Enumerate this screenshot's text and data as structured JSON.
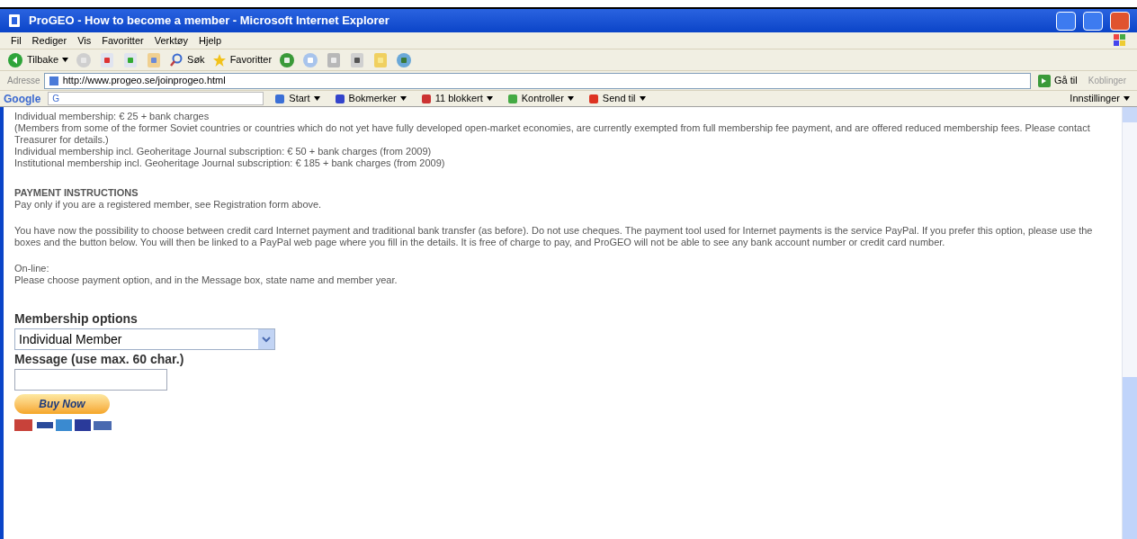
{
  "window": {
    "title": "ProGEO - How to become a member - Microsoft Internet Explorer"
  },
  "menu": [
    "Fil",
    "Rediger",
    "Vis",
    "Favoritter",
    "Verktøy",
    "Hjelp"
  ],
  "toolbar": {
    "back": "Tilbake",
    "search": "Søk",
    "favorites": "Favoritter"
  },
  "address": {
    "label": "Adresse",
    "url": "http://www.progeo.se/joinprogeo.html",
    "go": "Gå til",
    "links": "Koblinger"
  },
  "google_bar": {
    "logo": "Google",
    "search_box": "G",
    "items": [
      {
        "kind": "start",
        "label": "Start"
      },
      {
        "kind": "bookmarks",
        "label": "Bokmerker"
      },
      {
        "kind": "blocked",
        "label": "11 blokkert"
      },
      {
        "kind": "check",
        "label": "Kontroller"
      },
      {
        "kind": "send",
        "label": "Send til"
      }
    ],
    "settings": "Innstillinger"
  },
  "content": {
    "fees": [
      "Individual membership: € 25 + bank charges",
      "(Members from some of the former Soviet countries or countries which do not yet have fully developed open-market economies, are currently exempted from full membership fee payment, and are offered reduced membership fees. Please contact Treasurer for details.)",
      "Individual membership incl. Geoheritage Journal subscription: € 50 + bank charges (from 2009)",
      "Institutional membership incl. Geoheritage Journal subscription: € 185 + bank charges (from 2009)"
    ],
    "payment_heading": "PAYMENT INSTRUCTIONS",
    "payment_note": "Pay only if you are a registered member, see Registration form above.",
    "paypal_text": "You have now the possibility to choose between credit card Internet payment and traditional bank transfer (as before). Do not use cheques. The payment tool used for Internet payments is the service PayPal. If you prefer this option, please use the boxes and the button below. You will then be linked to a PayPal web page where you fill in the details. It is free of charge to pay, and ProGEO will not be able to see any bank account number or credit card number.",
    "online_label": "On-line:",
    "online_text": "Please choose payment option, and in the Message box, state name and member year.",
    "form": {
      "options_label": "Membership options",
      "option_value": "Individual Member",
      "message_label": "Message (use max. 60 char.)",
      "buy_button": "Buy Now"
    }
  }
}
